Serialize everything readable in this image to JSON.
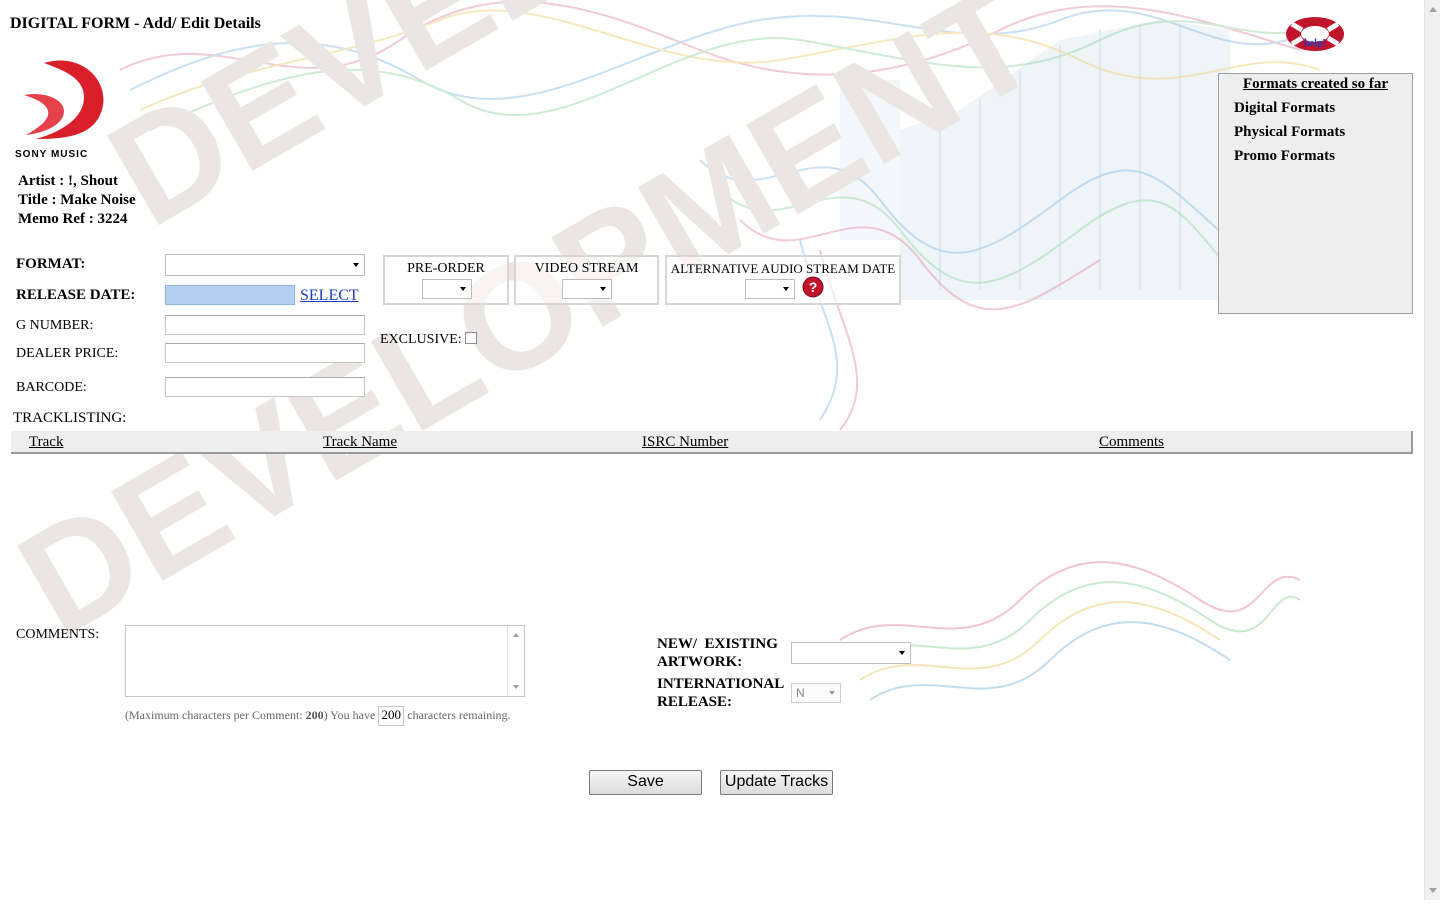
{
  "header": {
    "title": "DIGITAL FORM - Add/ Edit Details",
    "brand": "SONY MUSIC",
    "help_label": "help!"
  },
  "watermark": "DEVELOPMENT",
  "release": {
    "artist": "Artist : !, Shout",
    "title": "Title : Make Noise",
    "memo": "Memo Ref : 3224"
  },
  "form": {
    "format_label": "FORMAT:",
    "format_value": "",
    "release_date_label": "RELEASE DATE:",
    "release_date_value": "",
    "select_link": "SELECT",
    "g_number_label": "G NUMBER:",
    "g_number_value": "",
    "dealer_price_label": "DEALER PRICE:",
    "dealer_price_value": "",
    "barcode_label": "BARCODE:",
    "barcode_value": "",
    "pre_order_label": "PRE-ORDER",
    "video_stream_label": "VIDEO STREAM",
    "alt_audio_label": "ALTERNATIVE AUDIO STREAM DATE",
    "exclusive_label": "EXCLUSIVE:",
    "exclusive_checked": false
  },
  "formats_panel": {
    "title": "Formats created so far",
    "items": [
      "Digital Formats",
      "Physical Formats",
      "Promo Formats"
    ]
  },
  "tracklisting": {
    "label": "TRACKLISTING:",
    "columns": [
      "Track",
      "Track Name",
      "ISRC Number",
      "Comments"
    ],
    "rows": []
  },
  "comments": {
    "label": "COMMENTS:",
    "value": "",
    "note_prefix": "(Maximum characters per Comment: ",
    "max_chars": "200",
    "note_middle": ") You have ",
    "remaining": "200",
    "note_suffix": " characters remaining."
  },
  "artwork": {
    "label_line1": "NEW/  EXISTING",
    "label_line2": "ARTWORK:",
    "value": ""
  },
  "international": {
    "label_line1": "INTERNATIONAL",
    "label_line2": "RELEASE:",
    "value": "N"
  },
  "buttons": {
    "save": "Save",
    "update_tracks": "Update Tracks"
  },
  "colors": {
    "logo_red": "#d91f2a",
    "panel_bg": "#eeeeee",
    "link_blue": "#1a3cc1",
    "help_red": "#c0142c"
  }
}
